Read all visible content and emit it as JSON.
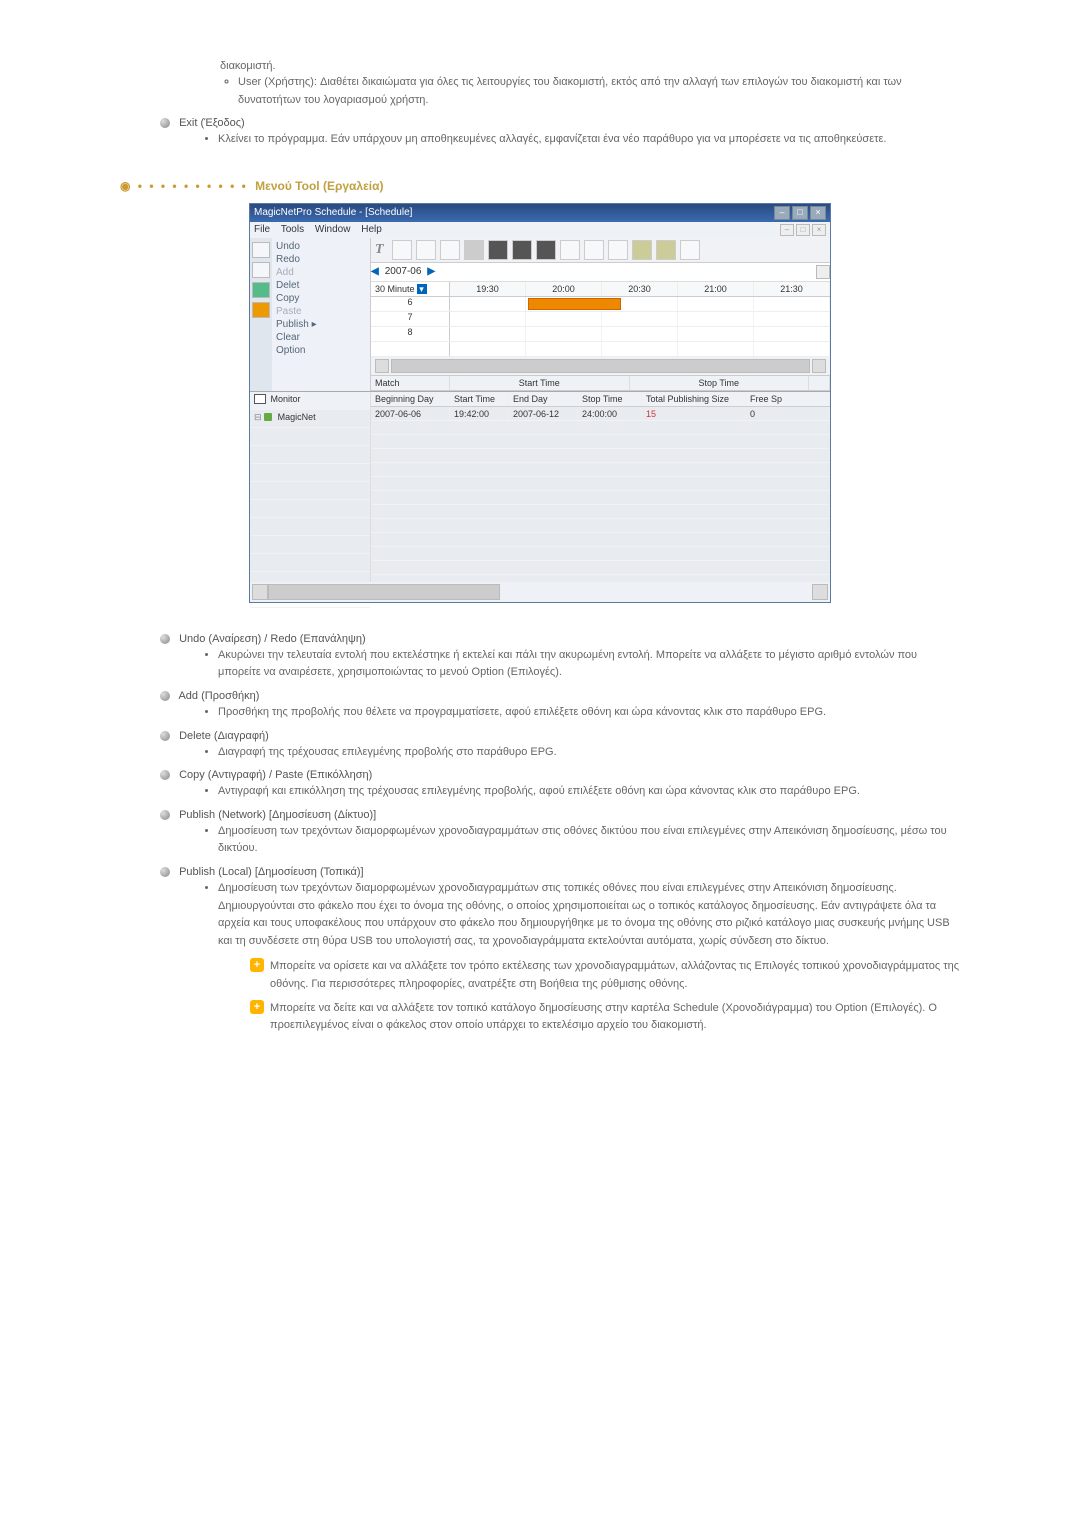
{
  "top": {
    "user_continuation": "διακομιστή.",
    "user_item": "User (Χρήστης): Διαθέτει δικαιώματα για όλες τις λειτουργίες του διακομιστή, εκτός από την αλλαγή των επιλογών του διακομιστή και των δυνατοτήτων του λογαριασμού χρήστη.",
    "exit_title": "Exit (Έξοδος)",
    "exit_item": "Κλείνει το πρόγραμμα. Εάν υπάρχουν μη αποθηκευμένες αλλαγές, εμφανίζεται ένα νέο παράθυρο για να μπορέσετε να τις αποθηκεύσετε."
  },
  "section_heading": "Μενού Tool (Εργαλεία)",
  "app": {
    "title": "MagicNetPro Schedule - [Schedule]",
    "menus": {
      "file": "File",
      "tools": "Tools",
      "window": "Window",
      "help": "Help"
    },
    "edit_menu": {
      "undo": "Undo",
      "redo": "Redo",
      "add": "Add",
      "delete": "Delet",
      "copy": "Copy",
      "paste": "Paste",
      "publish": "Publish  ▸",
      "clear": "Clear",
      "option": "Option"
    },
    "toolbar_label": "T",
    "date_label": "2007-06",
    "interval_label": "30 Minute",
    "time_cols": [
      "19:30",
      "20:00",
      "20:30",
      "21:00",
      "21:30"
    ],
    "row_labels": [
      "6",
      "7",
      "8",
      ""
    ],
    "footer_left": "Match",
    "footer_mid": "Start Time",
    "footer_right": "Stop Time",
    "monitor_label": "Monitor",
    "tree_node": "MagicNet",
    "columns": {
      "beginning_day": "Beginning Day",
      "start_time": "Start Time",
      "end_day": "End Day",
      "stop_time": "Stop Time",
      "total_pub": "Total Publishing Size",
      "free_sp": "Free Sp"
    },
    "row": {
      "beginning_day": "2007-06-06",
      "start_time": "19:42:00",
      "end_day": "2007-06-12",
      "stop_time": "24:00:00",
      "total_pub": "15",
      "free_sp": "0"
    }
  },
  "items": {
    "undo_title": "Undo (Αναίρεση) / Redo (Επανάληψη)",
    "undo_text": "Ακυρώνει την τελευταία εντολή που εκτελέστηκε ή εκτελεί και πάλι την ακυρωμένη εντολή. Μπορείτε να αλλάξετε το μέγιστο αριθμό εντολών που μπορείτε να αναιρέσετε, χρησιμοποιώντας το μενού Option (Επιλογές).",
    "add_title": "Add (Προσθήκη)",
    "add_text": "Προσθήκη της προβολής που θέλετε να προγραμματίσετε, αφού επιλέξετε οθόνη και ώρα κάνοντας κλικ στο παράθυρο EPG.",
    "delete_title": "Delete (Διαγραφή)",
    "delete_text": "Διαγραφή της τρέχουσας επιλεγμένης προβολής στο παράθυρο EPG.",
    "copy_title": "Copy (Αντιγραφή) / Paste (Επικόλληση)",
    "copy_text": "Αντιγραφή και επικόλληση της τρέχουσας επιλεγμένης προβολής, αφού επιλέξετε οθόνη και ώρα κάνοντας κλικ στο παράθυρο EPG.",
    "pubnet_title": "Publish (Network) [Δημοσίευση (Δίκτυο)]",
    "pubnet_text": "Δημοσίευση των τρεχόντων διαμορφωμένων χρονοδιαγραμμάτων στις οθόνες δικτύου που είναι επιλεγμένες στην Απεικόνιση δημοσίευσης, μέσω του δικτύου.",
    "publoc_title": "Publish (Local) [Δημοσίευση (Τοπικά)]",
    "publoc_text": "Δημοσίευση των τρεχόντων διαμορφωμένων χρονοδιαγραμμάτων στις τοπικές οθόνες που είναι επιλεγμένες στην Απεικόνιση δημοσίευσης. Δημιουργούνται στο φάκελο που έχει το όνομα της οθόνης, ο οποίος χρησιμοποιείται ως ο τοπικός κατάλογος δημοσίευσης. Εάν αντιγράψετε όλα τα αρχεία και τους υποφακέλους που υπάρχουν στο φάκελο που δημιουργήθηκε με το όνομα της οθόνης στο ριζικό κατάλογο μιας συσκευής μνήμης USB και τη συνδέσετε στη θύρα USB του υπολογιστή σας, τα χρονοδιαγράμματα εκτελούνται αυτόματα, χωρίς σύνδεση στο δίκτυο.",
    "note1": "Μπορείτε να ορίσετε και να αλλάξετε τον τρόπο εκτέλεσης των χρονοδιαγραμμάτων, αλλάζοντας τις Επιλογές τοπικού χρονοδιαγράμματος της οθόνης. Για περισσότερες πληροφορίες, ανατρέξτε στη Βοήθεια της ρύθμισης οθόνης.",
    "note2": "Μπορείτε να δείτε και να αλλάξετε τον τοπικό κατάλογο δημοσίευσης στην καρτέλα Schedule (Χρονοδιάγραμμα) του Option (Επιλογές). Ο προεπιλεγμένος είναι ο φάκελος στον οποίο υπάρχει το εκτελέσιμο αρχείο του διακομιστή."
  }
}
